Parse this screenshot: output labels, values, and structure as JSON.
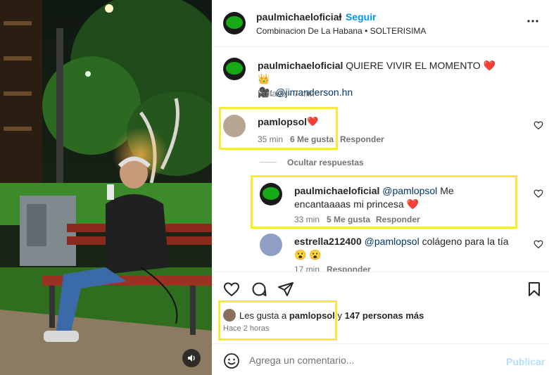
{
  "post": {
    "author": "paulmichaeloficial",
    "follow_label": "Seguir",
    "subtitle": "Combinacion De La Habana • SOLTERISIMA",
    "more_icon": "more-options-icon"
  },
  "caption": {
    "author": "paulmichaeloficial",
    "text": "QUIERE VIVIR EL MOMENTO",
    "emoji": "❤️ 👑",
    "credit_prefix": "🎥: ",
    "credit_mention": "@jimanderson.hn",
    "meta": "Editado · 7 min"
  },
  "comments": [
    {
      "author": "pamlopsol",
      "text": "❤️",
      "time": "35 min",
      "likes": "6 Me gusta",
      "reply": "Responder"
    }
  ],
  "replies_toggle": "Ocultar respuestas",
  "replies": [
    {
      "author": "paulmichaeloficial",
      "mention": "@pamlopsol",
      "text": "Me encantaaaas mi princesa",
      "emoji": "❤️",
      "time": "33 min",
      "likes": "5 Me gusta",
      "reply": "Responder"
    },
    {
      "author": "estrella212400",
      "mention": "@pamlopsol",
      "text": "colágeno para la tía",
      "emoji": "😮 😮",
      "time": "17 min",
      "reply": "Responder"
    }
  ],
  "likes": {
    "prefix": "Les gusta a",
    "user": "pamlopsol",
    "joiner": "y",
    "others": "147 personas más"
  },
  "time_ago": "Hace 2 horas",
  "composer": {
    "placeholder": "Agrega un comentario...",
    "publish_label": "Publicar"
  },
  "colors": {
    "accent_blue": "#0095f6",
    "heart_red": "#ed1c24",
    "highlight_yellow": "#f5e93b"
  }
}
